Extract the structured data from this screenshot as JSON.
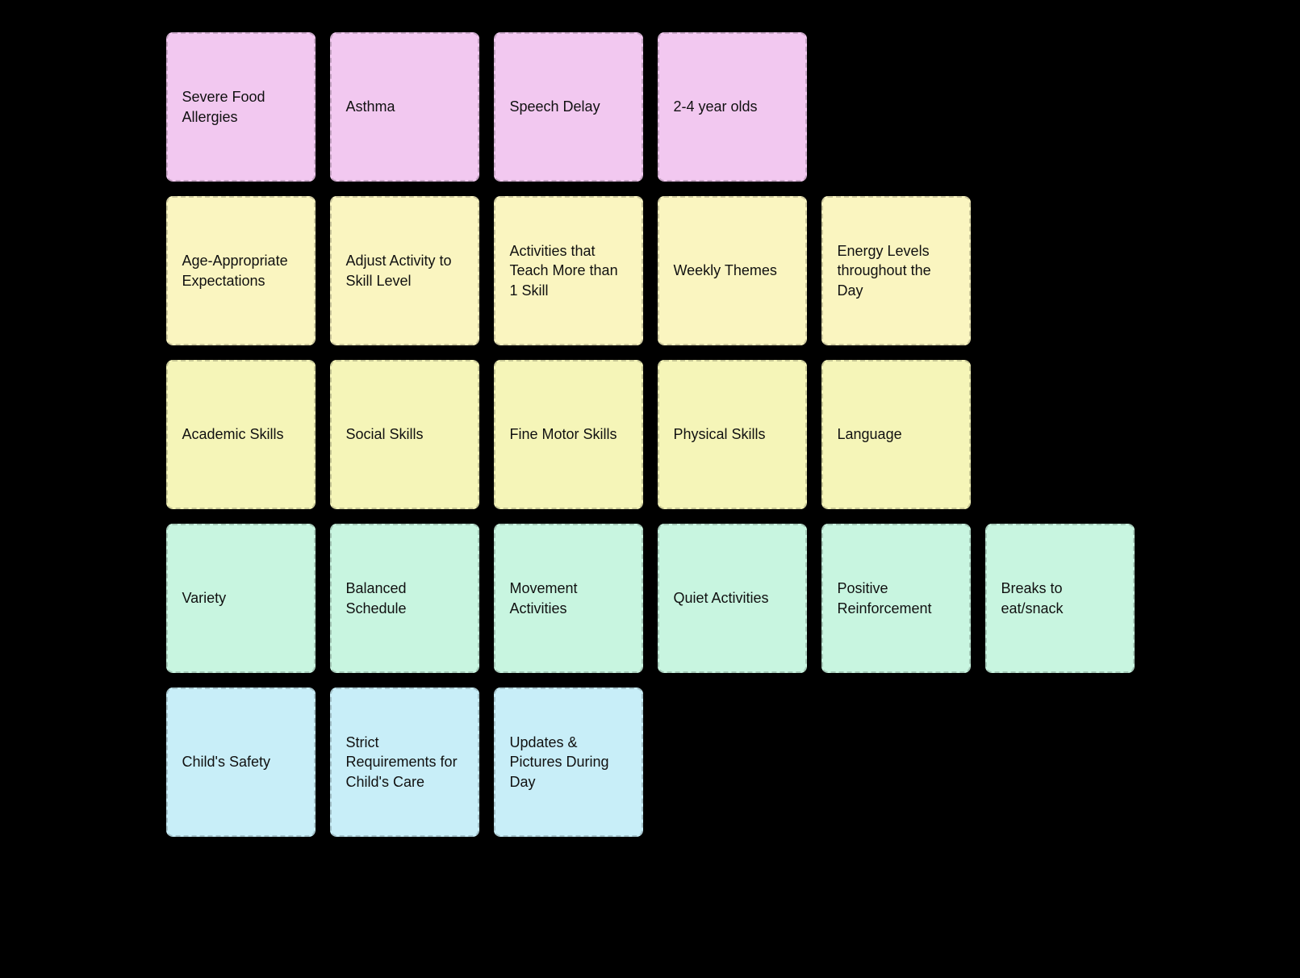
{
  "rows": [
    {
      "cards": [
        {
          "label": "Severe Food Allergies",
          "color": "pink"
        },
        {
          "label": "Asthma",
          "color": "pink"
        },
        {
          "label": "Speech Delay",
          "color": "pink"
        },
        {
          "label": "2-4 year olds",
          "color": "pink"
        }
      ]
    },
    {
      "cards": [
        {
          "label": "Age-Appropriate Expectations",
          "color": "yellow"
        },
        {
          "label": "Adjust Activity to Skill Level",
          "color": "yellow"
        },
        {
          "label": "Activities that Teach More than 1 Skill",
          "color": "yellow"
        },
        {
          "label": "Weekly Themes",
          "color": "yellow"
        },
        {
          "label": "Energy Levels throughout the Day",
          "color": "yellow"
        }
      ]
    },
    {
      "cards": [
        {
          "label": "Academic Skills",
          "color": "light-yellow"
        },
        {
          "label": "Social Skills",
          "color": "light-yellow"
        },
        {
          "label": "Fine Motor Skills",
          "color": "light-yellow"
        },
        {
          "label": "Physical Skills",
          "color": "light-yellow"
        },
        {
          "label": "Language",
          "color": "light-yellow"
        }
      ]
    },
    {
      "cards": [
        {
          "label": "Variety",
          "color": "mint"
        },
        {
          "label": "Balanced Schedule",
          "color": "mint"
        },
        {
          "label": "Movement Activities",
          "color": "mint"
        },
        {
          "label": "Quiet Activities",
          "color": "mint"
        },
        {
          "label": "Positive Reinforcement",
          "color": "mint"
        },
        {
          "label": "Breaks to eat/snack",
          "color": "mint"
        }
      ]
    },
    {
      "cards": [
        {
          "label": "Child's Safety",
          "color": "light-blue"
        },
        {
          "label": "Strict Requirements for Child's Care",
          "color": "light-blue"
        },
        {
          "label": "Updates & Pictures During Day",
          "color": "light-blue"
        }
      ]
    }
  ]
}
